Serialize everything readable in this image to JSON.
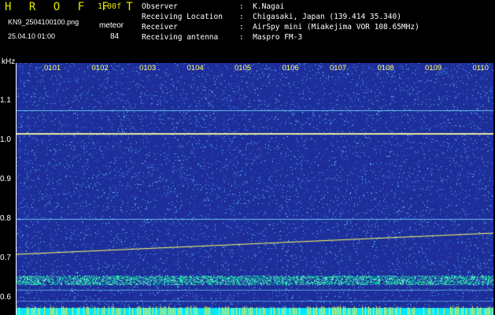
{
  "header": {
    "app_title": "H R O F F T",
    "version": "1.00f",
    "filename": "KN9_2504100100.png",
    "meteor_label": "meteor",
    "datetime": "25.04.10 01:00",
    "meteor_count": "84"
  },
  "info": {
    "rows": [
      {
        "key": "Observer",
        "value": "K.Nagai"
      },
      {
        "key": "Receiving Location",
        "value": "Chigasaki, Japan (139.414 35.340)"
      },
      {
        "key": "Receiver",
        "value": "AirSpy mini (Miakejima VOR 108.65MHz)"
      },
      {
        "key": "Receiving antenna",
        "value": "Maspro FM-3"
      }
    ]
  },
  "axis": {
    "unit": "kHz",
    "y_ticks": [
      "1.1",
      "1.0",
      "0.9",
      "0.8",
      "0.7",
      "0.6"
    ],
    "x_ticks": [
      "0101",
      "0102",
      "0103",
      "0104",
      "0105",
      "0106",
      "0107",
      "0108",
      "0109",
      "0110"
    ]
  },
  "colors": {
    "background": "#1d2e9a",
    "noise_dot": "#4fb8ff",
    "signal": "#ffff66",
    "band": "#00e0a0",
    "baseline": "#00e8ff"
  }
}
